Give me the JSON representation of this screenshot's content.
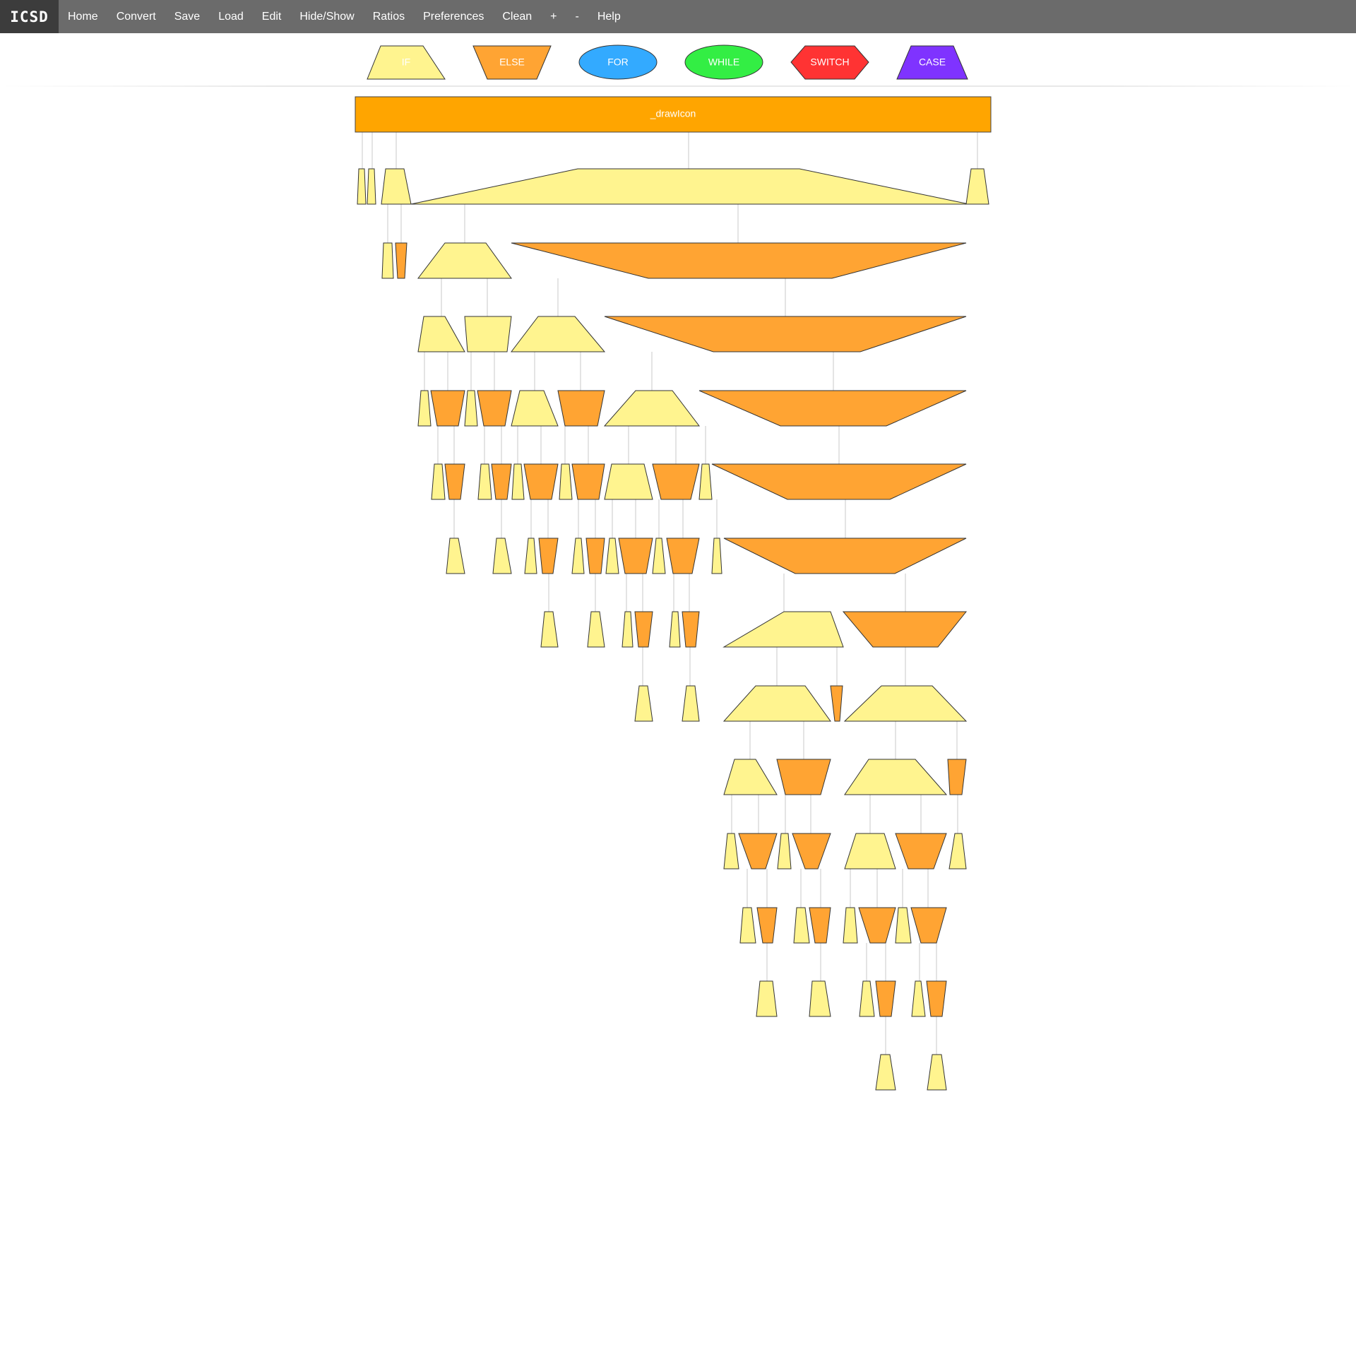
{
  "app": {
    "brand": "ICSD"
  },
  "menu": [
    {
      "id": "home",
      "label": "Home"
    },
    {
      "id": "convert",
      "label": "Convert"
    },
    {
      "id": "save",
      "label": "Save"
    },
    {
      "id": "load",
      "label": "Load"
    },
    {
      "id": "edit",
      "label": "Edit"
    },
    {
      "id": "hide-show",
      "label": "Hide/Show"
    },
    {
      "id": "ratios",
      "label": "Ratios"
    },
    {
      "id": "preferences",
      "label": "Preferences"
    },
    {
      "id": "clean",
      "label": "Clean"
    },
    {
      "id": "zoom-in",
      "label": "+"
    },
    {
      "id": "zoom-out",
      "label": "-"
    },
    {
      "id": "help",
      "label": "Help"
    }
  ],
  "legend": [
    {
      "kind": "if",
      "label": "IF",
      "color": "#fff48f"
    },
    {
      "kind": "else",
      "label": "ELSE",
      "color": "#ffa433"
    },
    {
      "kind": "for",
      "label": "FOR",
      "color": "#33aaff"
    },
    {
      "kind": "while",
      "label": "WHILE",
      "color": "#33ee44"
    },
    {
      "kind": "switch",
      "label": "SWITCH",
      "color": "#ff3333"
    },
    {
      "kind": "case",
      "label": "CASE",
      "color": "#7f33ff"
    }
  ],
  "diagram": {
    "function_name": "_drawIcon",
    "colors": {
      "function": "#ffa500",
      "if": "#fff48f",
      "else": "#ffa433",
      "stroke": "#333333",
      "connector": "#c8c8c8"
    }
  }
}
